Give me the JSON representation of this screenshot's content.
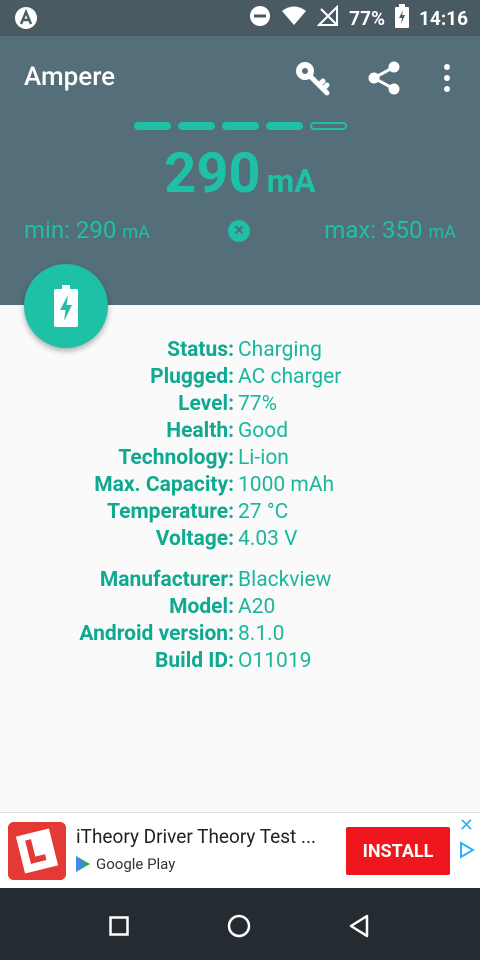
{
  "status_bar": {
    "battery_percent": "77%",
    "time": "14:16"
  },
  "app": {
    "title": "Ampere"
  },
  "meter": {
    "level_segments_filled": 4,
    "level_segments_total": 5,
    "current_value": "290",
    "current_unit": "mA",
    "min_label": "min: 290",
    "min_unit": "mA",
    "max_label": "max: 350",
    "max_unit": "mA",
    "accent_color": "#1ec0a6"
  },
  "battery_info": [
    {
      "key": "Status:",
      "value": "Charging"
    },
    {
      "key": "Plugged:",
      "value": "AC charger"
    },
    {
      "key": "Level:",
      "value": "77%"
    },
    {
      "key": "Health:",
      "value": "Good"
    },
    {
      "key": "Technology:",
      "value": "Li-ion"
    },
    {
      "key": "Max. Capacity:",
      "value": "1000 mAh"
    },
    {
      "key": "Temperature:",
      "value": "27 °C"
    },
    {
      "key": "Voltage:",
      "value": "4.03 V"
    }
  ],
  "device_info": [
    {
      "key": "Manufacturer:",
      "value": "Blackview"
    },
    {
      "key": "Model:",
      "value": "A20"
    },
    {
      "key": "Android version:",
      "value": "8.1.0"
    },
    {
      "key": "Build ID:",
      "value": "O11019"
    }
  ],
  "ad": {
    "title": "iTheory Driver Theory Test ...",
    "store": "Google Play",
    "install_label": "INSTALL",
    "close_glyph": "✕"
  }
}
